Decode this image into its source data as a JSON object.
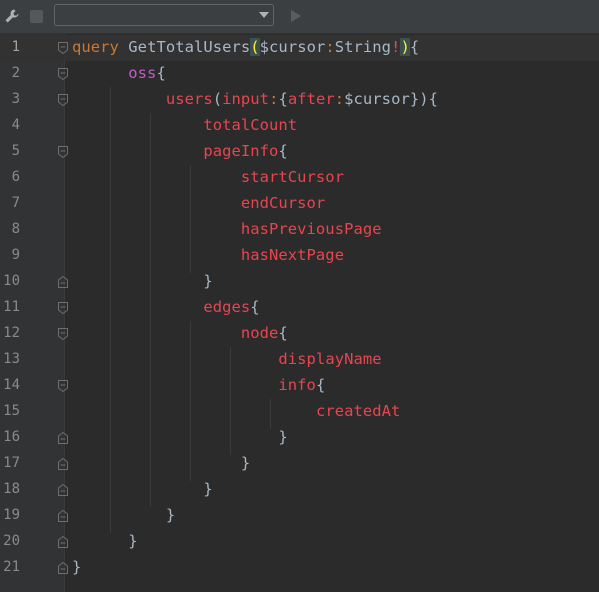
{
  "toolbar": {
    "wrench_icon": "wrench-icon",
    "stop_icon": "stop-icon",
    "endpoint_select_value": "",
    "run_icon": "play-icon"
  },
  "colors": {
    "background": "#2b2b2b",
    "gutter": "#313335",
    "keyword": "#cc7832",
    "field": "#e8454f",
    "operation_name": "#c05ec8",
    "text": "#a9b7c6",
    "brace_match_bg": "#3b514d"
  },
  "editor": {
    "current_line": 1,
    "lines": [
      {
        "number": "1",
        "tokens": [
          {
            "t": "query",
            "c": "kw"
          },
          {
            "t": " GetTotalUsers",
            "c": "var"
          },
          {
            "t": "(",
            "c": "pm"
          },
          {
            "t": "$cursor",
            "c": "var"
          },
          {
            "t": ":",
            "c": "kw"
          },
          {
            "t": "String",
            "c": "typ"
          },
          {
            "t": "!",
            "c": "bang"
          },
          {
            "t": ")",
            "c": "pm"
          },
          {
            "t": "{",
            "c": "br"
          }
        ]
      },
      {
        "number": "2",
        "tokens": [
          {
            "t": "      ",
            "c": "br"
          },
          {
            "t": "oss",
            "c": "op"
          },
          {
            "t": "{",
            "c": "br"
          }
        ]
      },
      {
        "number": "3",
        "tokens": [
          {
            "t": "          ",
            "c": "br"
          },
          {
            "t": "users",
            "c": "fld"
          },
          {
            "t": "(",
            "c": "br"
          },
          {
            "t": "input",
            "c": "fld"
          },
          {
            "t": ":",
            "c": "kw"
          },
          {
            "t": "{",
            "c": "br"
          },
          {
            "t": "after",
            "c": "fld"
          },
          {
            "t": ":",
            "c": "kw"
          },
          {
            "t": "$cursor",
            "c": "var"
          },
          {
            "t": "})",
            "c": "br"
          },
          {
            "t": "{",
            "c": "br"
          }
        ]
      },
      {
        "number": "4",
        "tokens": [
          {
            "t": "              ",
            "c": "br"
          },
          {
            "t": "totalCount",
            "c": "fld"
          }
        ]
      },
      {
        "number": "5",
        "tokens": [
          {
            "t": "              ",
            "c": "br"
          },
          {
            "t": "pageInfo",
            "c": "fld"
          },
          {
            "t": "{",
            "c": "br"
          }
        ]
      },
      {
        "number": "6",
        "tokens": [
          {
            "t": "                  ",
            "c": "br"
          },
          {
            "t": "startCursor",
            "c": "fld"
          }
        ]
      },
      {
        "number": "7",
        "tokens": [
          {
            "t": "                  ",
            "c": "br"
          },
          {
            "t": "endCursor",
            "c": "fld"
          }
        ]
      },
      {
        "number": "8",
        "tokens": [
          {
            "t": "                  ",
            "c": "br"
          },
          {
            "t": "hasPreviousPage",
            "c": "fld"
          }
        ]
      },
      {
        "number": "9",
        "tokens": [
          {
            "t": "                  ",
            "c": "br"
          },
          {
            "t": "hasNextPage",
            "c": "fld"
          }
        ]
      },
      {
        "number": "10",
        "tokens": [
          {
            "t": "              ",
            "c": "br"
          },
          {
            "t": "}",
            "c": "br"
          }
        ]
      },
      {
        "number": "11",
        "tokens": [
          {
            "t": "              ",
            "c": "br"
          },
          {
            "t": "edges",
            "c": "fld"
          },
          {
            "t": "{",
            "c": "br"
          }
        ]
      },
      {
        "number": "12",
        "tokens": [
          {
            "t": "                  ",
            "c": "br"
          },
          {
            "t": "node",
            "c": "fld"
          },
          {
            "t": "{",
            "c": "br"
          }
        ]
      },
      {
        "number": "13",
        "tokens": [
          {
            "t": "                      ",
            "c": "br"
          },
          {
            "t": "displayName",
            "c": "fld"
          }
        ]
      },
      {
        "number": "14",
        "tokens": [
          {
            "t": "                      ",
            "c": "br"
          },
          {
            "t": "info",
            "c": "fld"
          },
          {
            "t": "{",
            "c": "br"
          }
        ]
      },
      {
        "number": "15",
        "tokens": [
          {
            "t": "                          ",
            "c": "br"
          },
          {
            "t": "createdAt",
            "c": "fld"
          }
        ]
      },
      {
        "number": "16",
        "tokens": [
          {
            "t": "                      ",
            "c": "br"
          },
          {
            "t": "}",
            "c": "br"
          }
        ]
      },
      {
        "number": "17",
        "tokens": [
          {
            "t": "                  ",
            "c": "br"
          },
          {
            "t": "}",
            "c": "br"
          }
        ]
      },
      {
        "number": "18",
        "tokens": [
          {
            "t": "              ",
            "c": "br"
          },
          {
            "t": "}",
            "c": "br"
          }
        ]
      },
      {
        "number": "19",
        "tokens": [
          {
            "t": "          ",
            "c": "br"
          },
          {
            "t": "}",
            "c": "br"
          }
        ]
      },
      {
        "number": "20",
        "tokens": [
          {
            "t": "      ",
            "c": "br"
          },
          {
            "t": "}",
            "c": "br"
          }
        ]
      },
      {
        "number": "21",
        "tokens": [
          {
            "t": "}",
            "c": "br"
          }
        ]
      }
    ],
    "fold_markers": {
      "1": "open",
      "2": "open",
      "3": "open",
      "5": "open",
      "10": "close",
      "11": "open",
      "12": "open",
      "14": "open",
      "16": "close",
      "17": "close",
      "18": "close",
      "19": "close",
      "20": "close",
      "21": "close"
    }
  }
}
